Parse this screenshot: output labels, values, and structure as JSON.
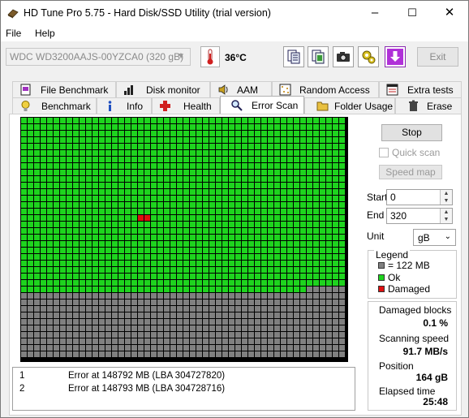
{
  "window": {
    "title": "HD Tune Pro 5.75 - Hard Disk/SSD Utility (trial version)",
    "minimize": "–",
    "maximize": "☐",
    "close": "✕"
  },
  "menu": {
    "file": "File",
    "help": "Help"
  },
  "toolbar": {
    "drive": "WDC WD3200AAJS-00YZCA0 (320 gB)",
    "temperature": "36°C",
    "exit": "Exit",
    "icons": [
      "copy-text-icon",
      "copy-screenshot-icon",
      "camera-icon",
      "settings-icon",
      "download-icon"
    ]
  },
  "tabs": {
    "top": [
      {
        "label": "File Benchmark",
        "icon": "file-benchmark-icon"
      },
      {
        "label": "Disk monitor",
        "icon": "disk-monitor-icon"
      },
      {
        "label": "AAM",
        "icon": "speaker-icon"
      },
      {
        "label": "Random Access",
        "icon": "random-access-icon"
      },
      {
        "label": "Extra tests",
        "icon": "extra-tests-icon"
      }
    ],
    "bottom": [
      {
        "label": "Benchmark",
        "icon": "benchmark-icon"
      },
      {
        "label": "Info",
        "icon": "info-icon"
      },
      {
        "label": "Health",
        "icon": "health-icon"
      },
      {
        "label": "Error Scan",
        "icon": "magnifier-icon"
      },
      {
        "label": "Folder Usage",
        "icon": "folder-icon"
      },
      {
        "label": "Erase",
        "icon": "trash-icon"
      }
    ],
    "active": "Error Scan"
  },
  "scan": {
    "stop": "Stop",
    "quick_scan": "Quick scan",
    "quick_scan_checked": false,
    "speed_map": "Speed map",
    "start_label": "Start",
    "start_value": "0",
    "end_label": "End",
    "end_value": "320",
    "unit_label": "Unit",
    "unit_value": "gB"
  },
  "legend": {
    "title": "Legend",
    "items": [
      {
        "label": "= 122 MB",
        "color": "#808080"
      },
      {
        "label": "Ok",
        "color": "#1ed41e"
      },
      {
        "label": "Damaged",
        "color": "#e01010"
      }
    ]
  },
  "stats": {
    "damaged_label": "Damaged blocks",
    "damaged_value": "0.1 %",
    "speed_label": "Scanning speed",
    "speed_value": "91.7 MB/s",
    "position_label": "Position",
    "position_value": "164 gB",
    "elapsed_label": "Elapsed time",
    "elapsed_value": "25:48"
  },
  "errors": [
    {
      "num": "1",
      "text": "Error at 148792 MB (LBA 304727820)"
    },
    {
      "num": "2",
      "text": "Error at 148793 MB (LBA 304728716)"
    }
  ],
  "block_map": {
    "columns": 50,
    "rows": 37,
    "scanned_blocks": 1344,
    "damaged_blocks": [
      768,
      769
    ],
    "colors": {
      "ok": "#1ed41e",
      "unscanned": "#808080",
      "damaged": "#e01010"
    }
  }
}
